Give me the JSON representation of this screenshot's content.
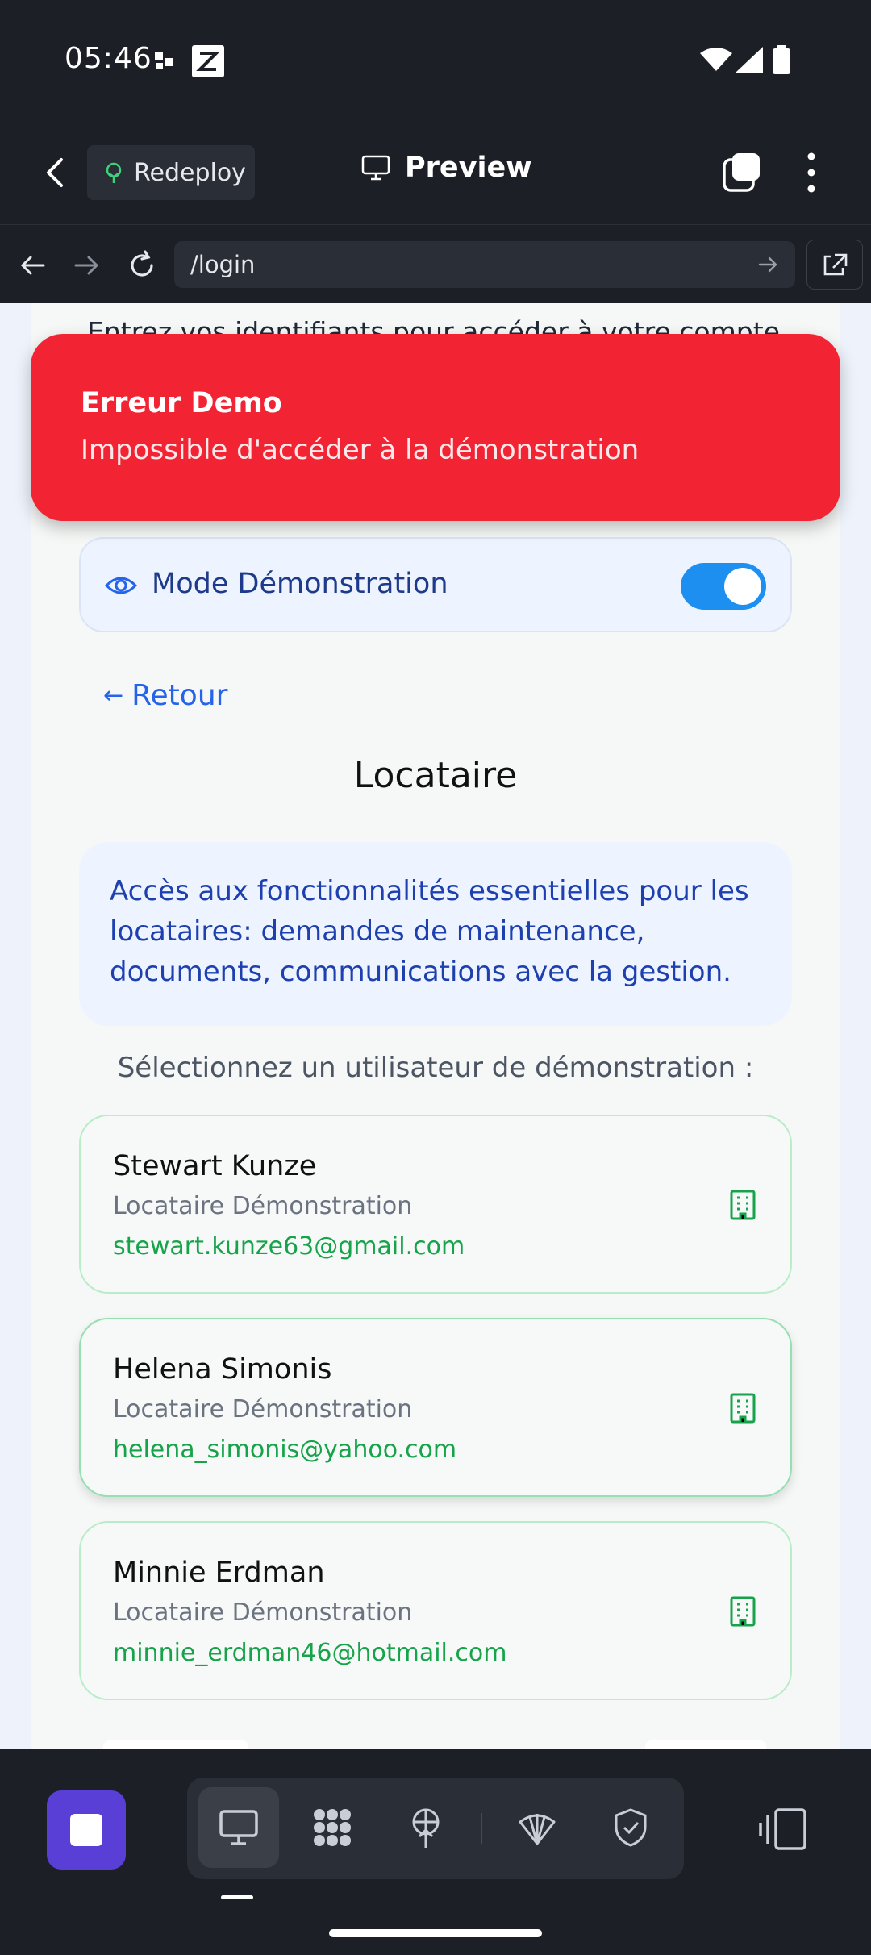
{
  "status": {
    "time": "05:46"
  },
  "header": {
    "redeploy_label": "Redeploy",
    "preview_label": "Preview"
  },
  "urlbar": {
    "url": "/login"
  },
  "page": {
    "subtitle": "Entrez vos identifiants pour accéder à votre compte",
    "demo_mode_label": "Mode Démonstration",
    "demo_mode_on": true,
    "back_label": "Retour",
    "role_title": "Locataire",
    "role_description": "Accès aux fonctionnalités essentielles pour les locataires: demandes de maintenance, documents, communications avec la gestion.",
    "select_hint": "Sélectionnez un utilisateur de démonstration :",
    "users": [
      {
        "name": "Stewart Kunze",
        "role": "Locataire Démonstration",
        "email": "stewart.kunze63@gmail.com"
      },
      {
        "name": "Helena Simonis",
        "role": "Locataire Démonstration",
        "email": "helena_simonis@yahoo.com"
      },
      {
        "name": "Minnie Erdman",
        "role": "Locataire Démonstration",
        "email": "minnie_erdman46@hotmail.com"
      }
    ]
  },
  "toast": {
    "title": "Erreur Demo",
    "message": "Impossible d'accéder à la démonstration"
  },
  "colors": {
    "accent": "#2563eb",
    "toast": "#f22433",
    "success": "#16a34a",
    "stop": "#5a3fd6"
  }
}
